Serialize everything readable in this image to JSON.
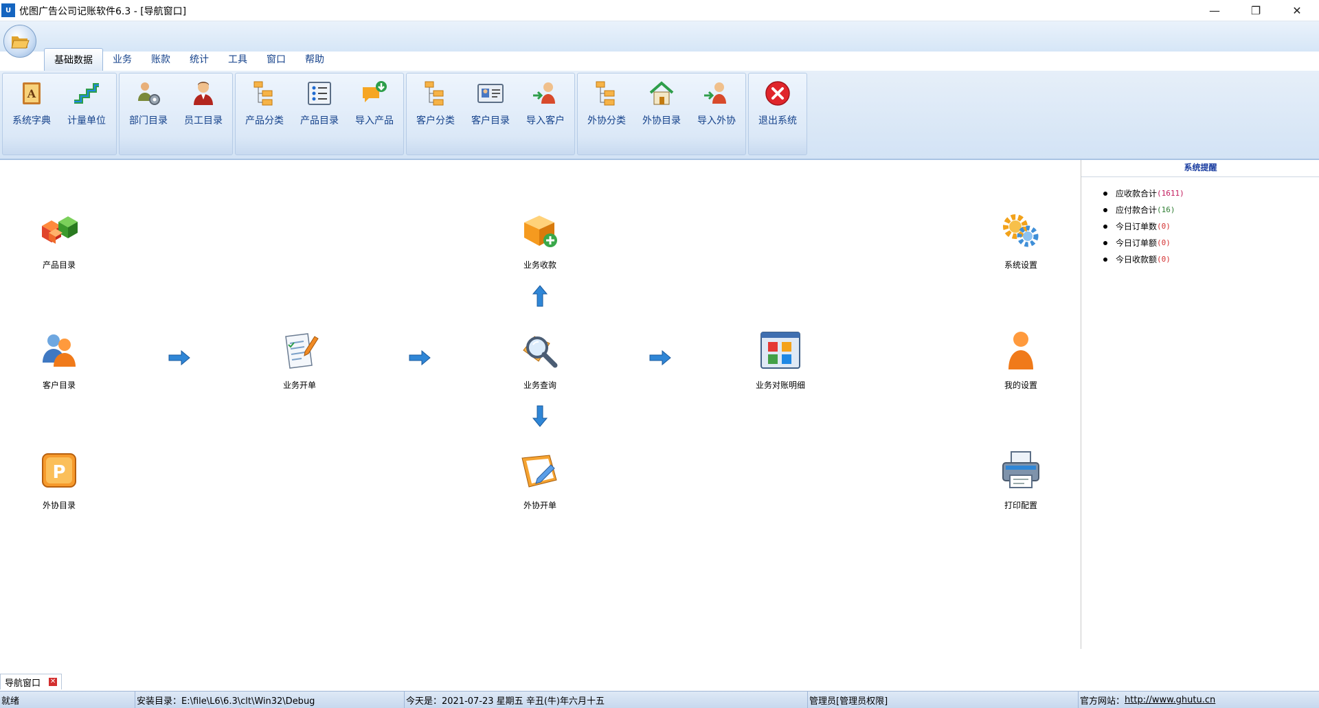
{
  "window": {
    "title": "优图广告公司记账软件6.3 - [导航窗口]",
    "logo_text": "U"
  },
  "ribbon": {
    "tabs": [
      {
        "label": "基础数据"
      },
      {
        "label": "业务"
      },
      {
        "label": "账款"
      },
      {
        "label": "统计"
      },
      {
        "label": "工具"
      },
      {
        "label": "窗口"
      },
      {
        "label": "帮助"
      }
    ],
    "buttons": {
      "sys_dict": "系统字典",
      "unit": "计量单位",
      "dept": "部门目录",
      "staff": "员工目录",
      "prod_cat": "产品分类",
      "prod_dir": "产品目录",
      "import_prod": "导入产品",
      "cust_cat": "客户分类",
      "cust_dir": "客户目录",
      "import_cust": "导入客户",
      "out_cat": "外协分类",
      "out_dir": "外协目录",
      "import_out": "导入外协",
      "exit": "退出系统"
    }
  },
  "nav": {
    "product_dir": "产品目录",
    "biz_receipt": "业务收款",
    "sys_settings": "系统设置",
    "customer_dir": "客户目录",
    "biz_order": "业务开单",
    "biz_query": "业务查询",
    "biz_statement": "业务对账明细",
    "my_settings": "我的设置",
    "outsource_dir": "外协目录",
    "outsource_order": "外协开单",
    "print_config": "打印配置"
  },
  "reminders": {
    "title": "系统提醒",
    "items": [
      {
        "label": "应收款合计",
        "count": "(1611)",
        "color": "#c2185b"
      },
      {
        "label": "应付款合计",
        "count": "(16)",
        "color": "#2e7d32"
      },
      {
        "label": "今日订单数",
        "count": "(0)",
        "color": "#d32f2f"
      },
      {
        "label": "今日订单额",
        "count": "(0)",
        "color": "#d32f2f"
      },
      {
        "label": "今日收款额",
        "count": "(0)",
        "color": "#d32f2f"
      }
    ]
  },
  "doc_tab": {
    "label": "导航窗口"
  },
  "status": {
    "state": "就绪",
    "install": "安装目录：E:\\file\\L6\\6.3\\clt\\Win32\\Debug",
    "today": "今天是：2021-07-23 星期五 辛丑(牛)年六月十五",
    "user": "管理员[管理员权限]",
    "site_label": "官方网站：",
    "site_url": "http://www.ghutu.cn"
  }
}
